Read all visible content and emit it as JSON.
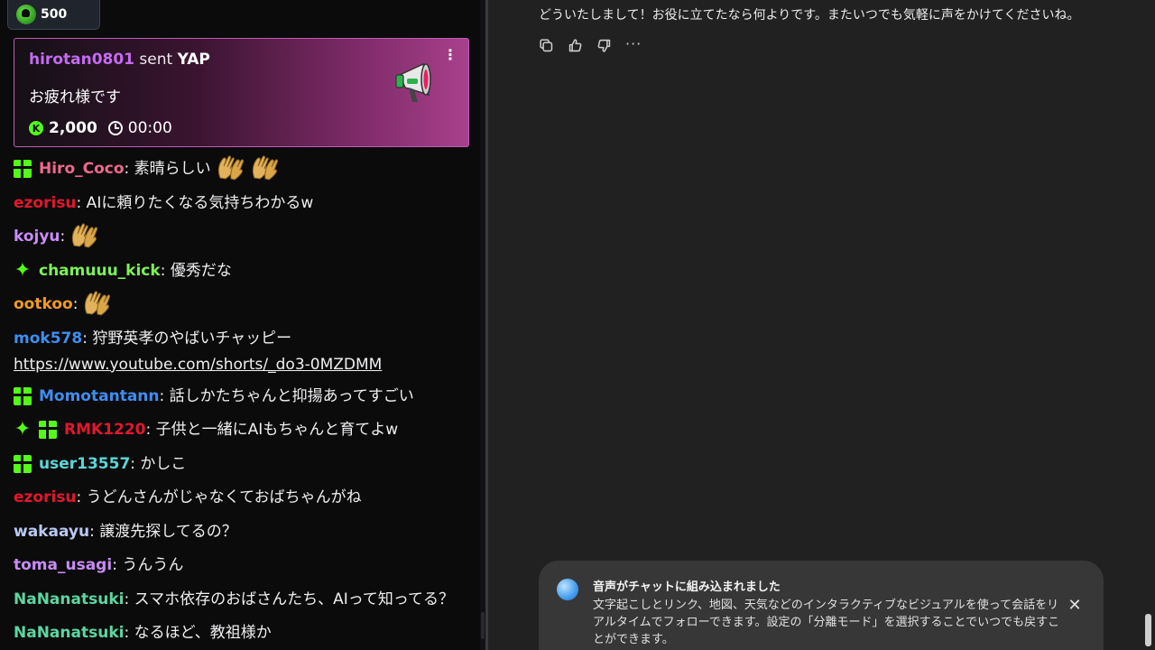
{
  "chat": {
    "gift_pill": {
      "amount": "500"
    },
    "yap_card": {
      "sender": "hirotan0801",
      "sent_word": "sent",
      "item": "YAP",
      "message": "お疲れ様です",
      "cost": "2,000",
      "duration": "00:00",
      "kebab": "⋮"
    },
    "messages": [
      {
        "badges": [
          "gift"
        ],
        "user": "Hiro_Coco",
        "color": "#f0688c",
        "sep": ":",
        "text": " 素晴らしい",
        "emotes": 2
      },
      {
        "badges": [],
        "user": "ezorisu",
        "color": "#e0182c",
        "sep": ":",
        "text": " AIに頼りたくなる気持ちわかるw",
        "emotes": 0
      },
      {
        "badges": [],
        "user": "kojyu",
        "color": "#c98cf5",
        "sep": ":",
        "text": "",
        "emotes": 1
      },
      {
        "badges": [
          "spark"
        ],
        "user": "chamuuu_kick",
        "color": "#7cf257",
        "sep": ":",
        "text": " 優秀だな",
        "emotes": 0
      },
      {
        "badges": [],
        "user": "ootkoo",
        "color": "#f29a22",
        "sep": ":",
        "text": "",
        "emotes": 1
      },
      {
        "badges": [],
        "user": "mok578",
        "color": "#3e8ef0",
        "sep": ":",
        "text": " 狩野英孝のやばいチャッピー",
        "link": "https://www.youtube.com/shorts/_do3-0MZDMM",
        "emotes": 0
      },
      {
        "badges": [
          "gift"
        ],
        "user": "Momotantann",
        "color": "#3e8ef0",
        "sep": ":",
        "text": " 話しかたちゃんと抑揚あってすごい",
        "emotes": 0
      },
      {
        "badges": [
          "spark",
          "gift"
        ],
        "user": "RMK1220",
        "color": "#e0182c",
        "sep": ":",
        "text": " 子供と一緒にAIもちゃんと育てよw",
        "emotes": 0
      },
      {
        "badges": [
          "gift"
        ],
        "user": "user13557",
        "color": "#5bd6d8",
        "sep": ":",
        "text": " かしこ",
        "emotes": 0
      },
      {
        "badges": [],
        "user": "ezorisu",
        "color": "#e0182c",
        "sep": ":",
        "text": " うどんさんがじゃなくておばちゃんがね",
        "emotes": 0
      },
      {
        "badges": [],
        "user": "wakaayu",
        "color": "#b9c9f0",
        "sep": ":",
        "text": " 譲渡先探してるの？",
        "emotes": 0
      },
      {
        "badges": [],
        "user": "toma_usagi",
        "color": "#c98cf5",
        "sep": ":",
        "text": " うんうん",
        "emotes": 0
      },
      {
        "badges": [],
        "user": "NaNanatsuki",
        "color": "#5bd6a0",
        "sep": ":",
        "text": " スマホ依存のおばさんたち、AIって知ってる？",
        "emotes": 0
      },
      {
        "badges": [],
        "user": "NaNanatsuki",
        "color": "#5bd6a0",
        "sep": ":",
        "text": " なるほど、教祖様か",
        "emotes": 0
      }
    ]
  },
  "assistant": {
    "reply": "どういたしまして！お役に立てたなら何よりです。またいつでも気軽に声をかけてくださいね。",
    "actions": [
      {
        "name": "copy-icon"
      },
      {
        "name": "thumbs-up-icon"
      },
      {
        "name": "thumbs-down-icon"
      },
      {
        "name": "more-icon",
        "glyph": "···"
      }
    ],
    "toast": {
      "title": "音声がチャットに組み込まれました",
      "body": "文字起こしとリンク、地図、天気などのインタラクティブなビジュアルを使って会話をリアルタイムでフォローできます。設定の「分離モード」を選択することでいつでも戻すことができます。",
      "close": "✕"
    }
  }
}
